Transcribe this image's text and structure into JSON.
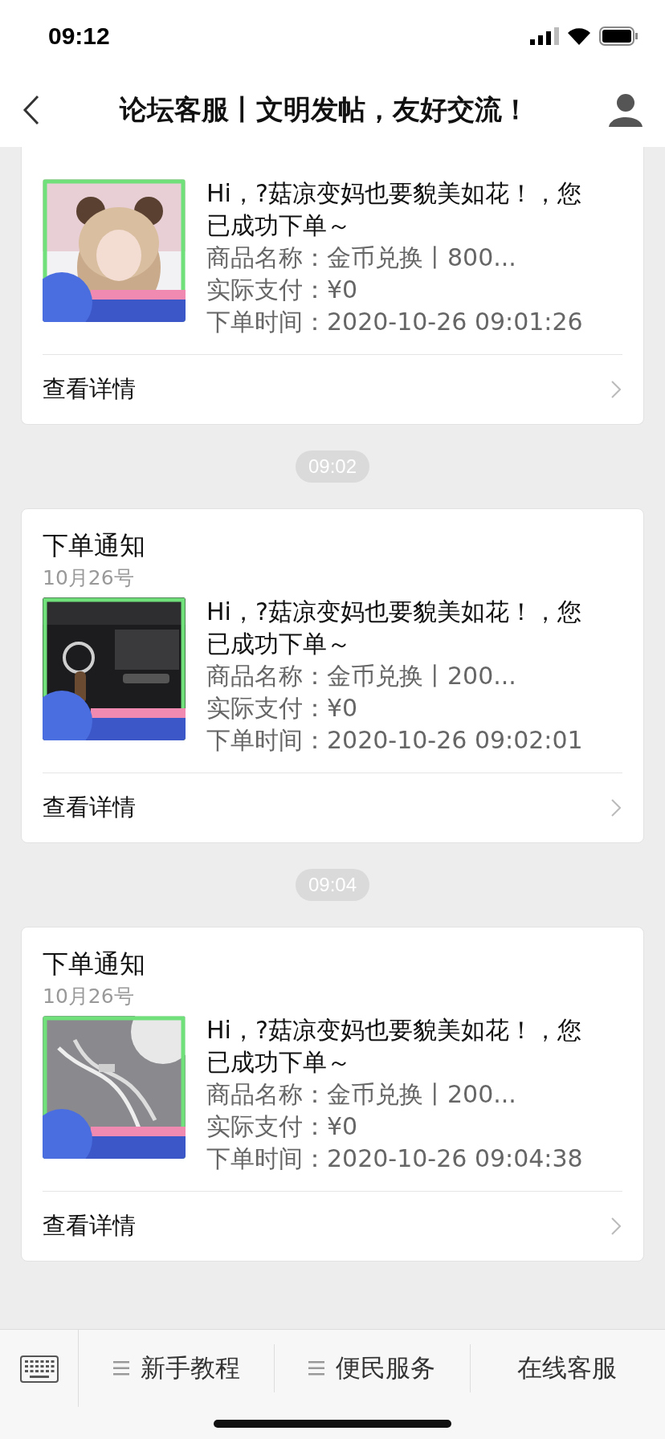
{
  "status_bar": {
    "time": "09:12"
  },
  "nav": {
    "title": "论坛客服丨文明发帖，友好交流！"
  },
  "messages": [
    {
      "kind": "card",
      "greeting": "Hi，?菇凉变妈也要貌美如花！，您已成功下单～",
      "product": "商品名称：金币兑换丨800...",
      "paid": "实际支付：¥0",
      "ordered": "下单时间：2020-10-26 09:01:26",
      "details": "查看详情"
    },
    {
      "kind": "time",
      "text": "09:02"
    },
    {
      "kind": "card",
      "title": "下单通知",
      "date": "10月26号",
      "greeting": "Hi，?菇凉变妈也要貌美如花！，您已成功下单～",
      "product": "商品名称：金币兑换丨200...",
      "paid": "实际支付：¥0",
      "ordered": "下单时间：2020-10-26 09:02:01",
      "details": "查看详情"
    },
    {
      "kind": "time",
      "text": "09:04"
    },
    {
      "kind": "card",
      "title": "下单通知",
      "date": "10月26号",
      "greeting": "Hi，?菇凉变妈也要貌美如花！，您已成功下单～",
      "product": "商品名称：金币兑换丨200...",
      "paid": "实际支付：¥0",
      "ordered": "下单时间：2020-10-26 09:04:38",
      "details": "查看详情"
    }
  ],
  "menu": [
    {
      "label": "新手教程",
      "kind": "list"
    },
    {
      "label": "便民服务",
      "kind": "list"
    },
    {
      "label": "在线客服",
      "kind": "plain"
    }
  ]
}
